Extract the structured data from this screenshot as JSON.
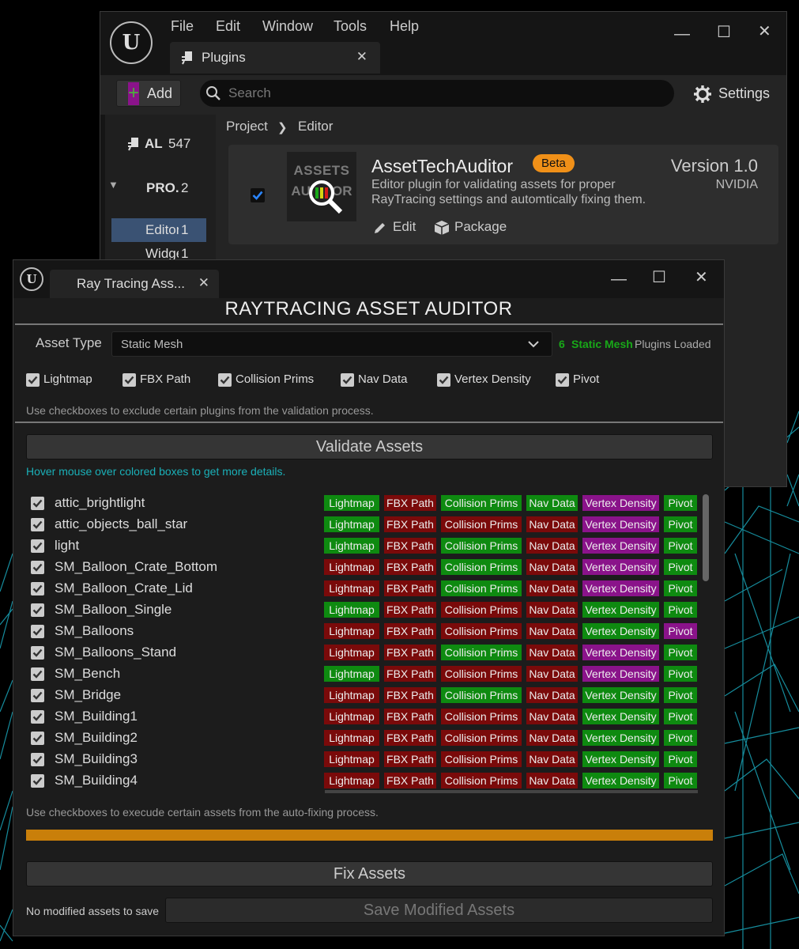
{
  "colors": {
    "green": "#0e8a10",
    "red": "#7a0a0a",
    "purple": "#8a138a",
    "accent": "#f09018",
    "progress": "#c97f0a"
  },
  "plugins_window": {
    "menu": [
      "File",
      "Edit",
      "Window",
      "Tools",
      "Help"
    ],
    "tab_title": "Plugins",
    "add_label": "Add",
    "search_placeholder": "Search",
    "settings_label": "Settings",
    "sidebar": {
      "all": {
        "label": "AL",
        "count": "547"
      },
      "project": {
        "label": "PRO.",
        "count": "2"
      },
      "editor": {
        "label": "Editor",
        "count": "1"
      },
      "widget": {
        "label": "Widge",
        "count": "1"
      }
    },
    "breadcrumb": [
      "Project",
      "Editor"
    ],
    "plugin": {
      "name": "AssetTechAuditor",
      "badge": "Beta",
      "description_line1": "Editor plugin for validating assets for proper",
      "description_line2": "RayTracing settings and automtically fixing them.",
      "version": "Version 1.0",
      "vendor": "NVIDIA",
      "edit_label": "Edit",
      "package_label": "Package",
      "thumb_line1": "ASSETS",
      "thumb_line2": "AUDITOR",
      "enabled": true
    }
  },
  "auditor_window": {
    "tab_title": "Ray Tracing Ass...",
    "title": "RAYTRACING  ASSET AUDITOR",
    "asset_type_label": "Asset Type",
    "asset_type_value": "Static Mesh",
    "loaded_count": "6",
    "loaded_type": "Static Mesh",
    "loaded_suffix": "Plugins Loaded",
    "plugin_checkboxes": [
      "Lightmap",
      "FBX Path",
      "Collision Prims",
      "Nav Data",
      "Vertex Density",
      "Pivot"
    ],
    "plugin_hint": "Use checkboxes to exclude certain plugins from the validation process.",
    "validate_label": "Validate Assets",
    "hover_hint": "Hover mouse over colored boxes to get more details.",
    "columns": [
      "Lightmap",
      "FBX Path",
      "Collision Prims",
      "Nav Data",
      "Vertex Density",
      "Pivot"
    ],
    "assets": [
      {
        "name": "attic_brightlight",
        "status": [
          "g",
          "r",
          "g",
          "g",
          "p",
          "g"
        ]
      },
      {
        "name": "attic_objects_ball_star",
        "status": [
          "g",
          "r",
          "r",
          "r",
          "p",
          "g"
        ]
      },
      {
        "name": "light",
        "status": [
          "g",
          "r",
          "g",
          "r",
          "p",
          "g"
        ]
      },
      {
        "name": "SM_Balloon_Crate_Bottom",
        "status": [
          "r",
          "r",
          "g",
          "r",
          "p",
          "g"
        ]
      },
      {
        "name": "SM_Balloon_Crate_Lid",
        "status": [
          "r",
          "r",
          "g",
          "r",
          "p",
          "g"
        ]
      },
      {
        "name": "SM_Balloon_Single",
        "status": [
          "g",
          "r",
          "r",
          "r",
          "g",
          "g"
        ]
      },
      {
        "name": "SM_Balloons",
        "status": [
          "r",
          "r",
          "r",
          "r",
          "g",
          "p"
        ]
      },
      {
        "name": "SM_Balloons_Stand",
        "status": [
          "r",
          "r",
          "g",
          "r",
          "p",
          "g"
        ]
      },
      {
        "name": "SM_Bench",
        "status": [
          "g",
          "r",
          "r",
          "r",
          "p",
          "g"
        ]
      },
      {
        "name": "SM_Bridge",
        "status": [
          "r",
          "r",
          "g",
          "r",
          "g",
          "g"
        ]
      },
      {
        "name": "SM_Building1",
        "status": [
          "r",
          "r",
          "r",
          "r",
          "g",
          "g"
        ]
      },
      {
        "name": "SM_Building2",
        "status": [
          "r",
          "r",
          "r",
          "r",
          "g",
          "g"
        ]
      },
      {
        "name": "SM_Building3",
        "status": [
          "r",
          "r",
          "r",
          "r",
          "g",
          "g"
        ]
      },
      {
        "name": "SM_Building4",
        "status": [
          "r",
          "r",
          "r",
          "r",
          "g",
          "g"
        ]
      }
    ],
    "asset_hint": "Use checkboxes to execude certain assets from the auto-fixing process.",
    "progress": 1.0,
    "fix_label": "Fix Assets",
    "save_status": "No modified assets to save",
    "save_label": "Save Modified Assets"
  }
}
